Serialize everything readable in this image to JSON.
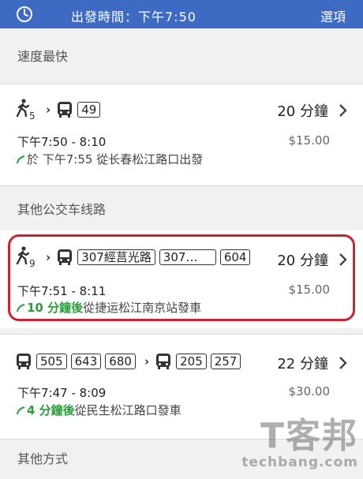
{
  "topbar": {
    "departure_label": "出發時間：下午7:50",
    "options_label": "選項",
    "bg_color": "#3d6bc4"
  },
  "sections": {
    "fastest": "速度最快",
    "other_bus": "其他公交车线路",
    "other_ways": "其他方式"
  },
  "routes": [
    {
      "walk_minutes": "5",
      "buses": [
        "49"
      ],
      "duration": "20 分鐘",
      "times": "下午7:50 - 8:10",
      "price": "$15.00",
      "departure_prefix": "於 下午7:55 從长春松江路口出發",
      "departure_highlight": "",
      "departure_rest": ""
    },
    {
      "walk_minutes": "9",
      "buses": [
        "307經莒光路",
        "307…",
        "604"
      ],
      "duration": "20 分鐘",
      "times": "下午7:51 - 8:11",
      "price": "$15.00",
      "departure_prefix": "",
      "departure_highlight": "10 分鐘後",
      "departure_rest": "從捷运松江南京站發車"
    },
    {
      "buses_leg1": [
        "505",
        "643",
        "680"
      ],
      "buses_leg2": [
        "205",
        "257"
      ],
      "duration": "22 分鐘",
      "times": "下午7:47 - 8:09",
      "price": "$30.00",
      "departure_prefix": "",
      "departure_highlight": "4 分鐘後",
      "departure_rest": "從民生松江路口發車"
    }
  ],
  "watermark": {
    "main": "T客邦",
    "site": "techbang.com"
  },
  "colors": {
    "highlight_border": "#cf2230",
    "realtime_green": "#2e9d3e"
  }
}
